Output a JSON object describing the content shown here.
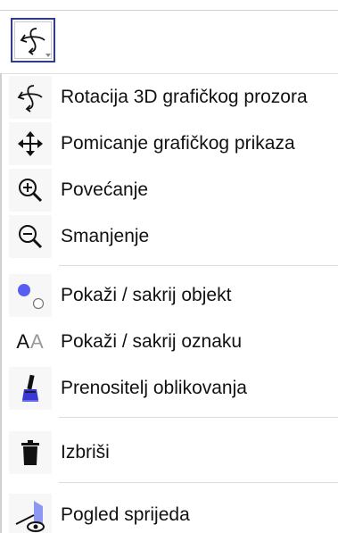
{
  "toolbar": {
    "active_tool_icon": "rotate-3d-icon"
  },
  "menu": {
    "groups": [
      {
        "items": [
          {
            "icon": "rotate-3d-icon",
            "label": "Rotacija 3D grafičkog prozora"
          },
          {
            "icon": "move-view-icon",
            "label": "Pomicanje grafičkog prikaza"
          },
          {
            "icon": "zoom-in-icon",
            "label": "Povećanje"
          },
          {
            "icon": "zoom-out-icon",
            "label": "Smanjenje"
          }
        ]
      },
      {
        "items": [
          {
            "icon": "show-hide-object-icon",
            "label": "Pokaži / sakrij objekt"
          },
          {
            "icon": "show-hide-label-icon",
            "label": "Pokaži / sakrij oznaku",
            "icon_text": "AA"
          },
          {
            "icon": "copy-style-brush-icon",
            "label": "Prenositelj oblikovanja"
          }
        ]
      },
      {
        "items": [
          {
            "icon": "trash-icon",
            "label": "Izbriši"
          }
        ]
      },
      {
        "items": [
          {
            "icon": "view-front-icon",
            "label": "Pogled sprijeda"
          }
        ]
      }
    ]
  },
  "colors": {
    "selected_border": "#2e3b8f",
    "object_dot": "#5a5ef0",
    "brush_blue": "#3a3ad0",
    "view_plane": "#8f98f0"
  }
}
